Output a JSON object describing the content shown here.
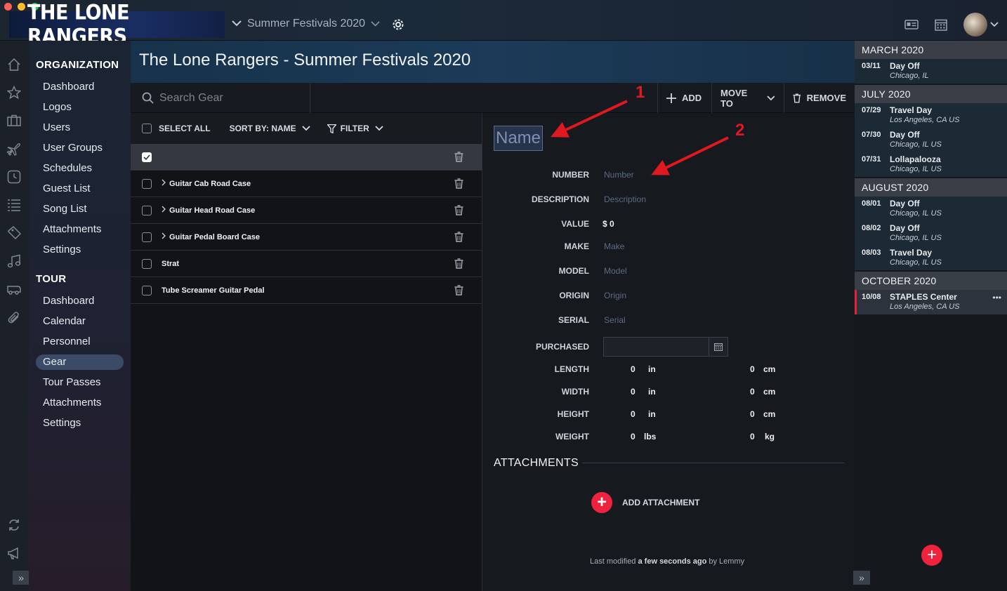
{
  "app": {
    "logo_text": "THE LONE RANGERS",
    "tour_selector": "Summer Festivals 2020",
    "window_controls": [
      "close",
      "minimize",
      "zoom"
    ],
    "colors": {
      "accent": "#f0233f",
      "active_nav": "#3b4a66",
      "annotation": "#e0181f"
    }
  },
  "header": {
    "title": "The Lone Rangers - Summer Festivals 2020"
  },
  "nav": {
    "organization_heading": "ORGANIZATION",
    "organization_items": [
      "Dashboard",
      "Logos",
      "Users",
      "User Groups",
      "Schedules",
      "Guest List",
      "Song List",
      "Attachments",
      "Settings"
    ],
    "tour_heading": "TOUR",
    "tour_items": [
      "Dashboard",
      "Calendar",
      "Personnel",
      "Gear",
      "Tour Passes",
      "Attachments",
      "Settings"
    ],
    "active_item": "Gear"
  },
  "rail_icons": [
    "home-icon",
    "star-icon",
    "briefcase-icon",
    "plane-icon",
    "clock-icon",
    "list-icon",
    "tag-icon",
    "music-icon",
    "bus-icon",
    "paperclip-icon",
    "sync-icon",
    "megaphone-icon"
  ],
  "toolbar": {
    "search_placeholder": "Search Gear",
    "add_label": "ADD",
    "move_to_label": "MOVE TO",
    "remove_label": "REMOVE"
  },
  "list": {
    "select_all_label": "SELECT ALL",
    "sort_label": "SORT BY: NAME",
    "filter_label": "FILTER",
    "rows": [
      {
        "name": "",
        "selected": true,
        "expandable": false
      },
      {
        "name": "Guitar Cab Road Case",
        "selected": false,
        "expandable": true
      },
      {
        "name": "Guitar Head Road Case",
        "selected": false,
        "expandable": true
      },
      {
        "name": "Guitar Pedal Board Case",
        "selected": false,
        "expandable": true
      },
      {
        "name": "Strat",
        "selected": false,
        "expandable": false
      },
      {
        "name": "Tube Screamer Guitar Pedal",
        "selected": false,
        "expandable": false
      }
    ]
  },
  "detail": {
    "name_placeholder": "Name",
    "fields": [
      {
        "label": "NUMBER",
        "value": "Number",
        "placeholder": true
      },
      {
        "label": "DESCRIPTION",
        "value": "Description",
        "placeholder": true
      },
      {
        "label": "VALUE",
        "value": "$ 0",
        "placeholder": false
      },
      {
        "label": "MAKE",
        "value": "Make",
        "placeholder": true
      },
      {
        "label": "MODEL",
        "value": "Model",
        "placeholder": true
      },
      {
        "label": "ORIGIN",
        "value": "Origin",
        "placeholder": true
      },
      {
        "label": "SERIAL",
        "value": "Serial",
        "placeholder": true
      }
    ],
    "purchased_label": "PURCHASED",
    "purchased_value": "",
    "dimensions": [
      {
        "label": "LENGTH",
        "imperial": "0",
        "imperial_unit": "in",
        "metric": "0",
        "metric_unit": "cm"
      },
      {
        "label": "WIDTH",
        "imperial": "0",
        "imperial_unit": "in",
        "metric": "0",
        "metric_unit": "cm"
      },
      {
        "label": "HEIGHT",
        "imperial": "0",
        "imperial_unit": "in",
        "metric": "0",
        "metric_unit": "cm"
      },
      {
        "label": "WEIGHT",
        "imperial": "0",
        "imperial_unit": "lbs",
        "metric": "0",
        "metric_unit": "kg"
      }
    ],
    "attachments_title": "ATTACHMENTS",
    "add_attachment_label": "ADD ATTACHMENT",
    "modified_prefix": "Last modified",
    "modified_when": "a few seconds ago",
    "modified_by": "by Lemmy"
  },
  "annotations": {
    "marker_1": "1",
    "marker_2": "2"
  },
  "schedule": {
    "months": [
      {
        "name": "MARCH 2020",
        "events": [
          {
            "date": "03/11",
            "title": "Day Off",
            "location": "Chicago, IL"
          }
        ]
      },
      {
        "name": "JULY 2020",
        "events": [
          {
            "date": "07/29",
            "title": "Travel Day",
            "location": "Los Angeles, CA US"
          },
          {
            "date": "07/30",
            "title": "Day Off",
            "location": "Chicago, IL US"
          },
          {
            "date": "07/31",
            "title": "Lollapalooza",
            "location": "Chicago, IL US"
          }
        ]
      },
      {
        "name": "AUGUST 2020",
        "events": [
          {
            "date": "08/01",
            "title": "Day Off",
            "location": "Chicago, IL US"
          },
          {
            "date": "08/02",
            "title": "Day Off",
            "location": "Chicago, IL US"
          },
          {
            "date": "08/03",
            "title": "Travel Day",
            "location": "Chicago, IL US"
          }
        ]
      },
      {
        "name": "OCTOBER 2020",
        "events": [
          {
            "date": "10/08",
            "title": "STAPLES Center",
            "location": "Los Angeles, CA US",
            "current": true
          }
        ]
      }
    ],
    "more_label": "•••"
  }
}
